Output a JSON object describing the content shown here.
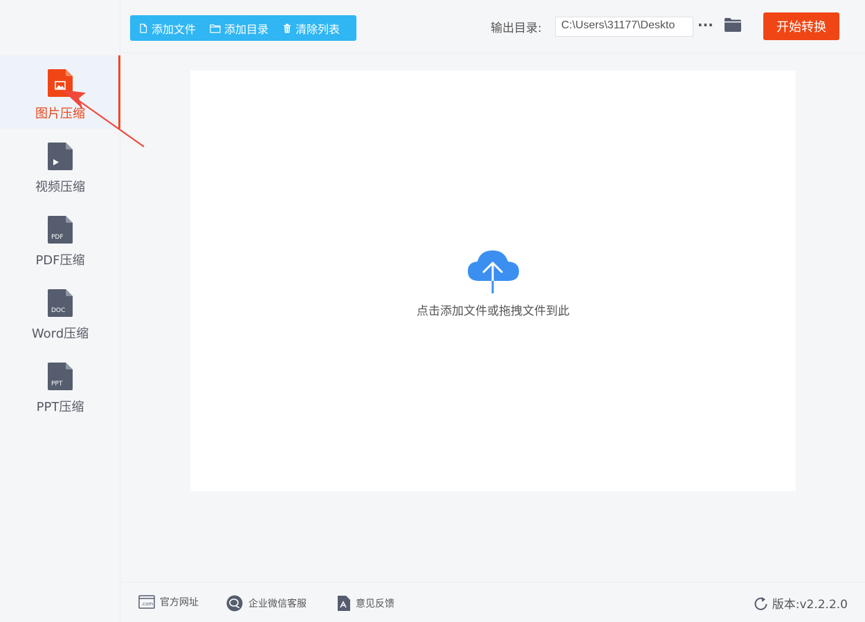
{
  "sidebar": {
    "items": [
      {
        "label": "图片压缩",
        "icon": "image-file-icon",
        "active": true
      },
      {
        "label": "视频压缩",
        "icon": "video-file-icon",
        "badge": "▶"
      },
      {
        "label": "PDF压缩",
        "icon": "pdf-file-icon",
        "badge": "PDF"
      },
      {
        "label": "Word压缩",
        "icon": "doc-file-icon",
        "badge": "DOC"
      },
      {
        "label": "PPT压缩",
        "icon": "ppt-file-icon",
        "badge": "PPT"
      }
    ]
  },
  "toolbar": {
    "add_file": "添加文件",
    "add_folder": "添加目录",
    "clear_list": "清除列表",
    "output_label": "输出目录:",
    "output_path": "C:\\Users\\31177\\Deskto",
    "more": "···",
    "start": "开始转换"
  },
  "main": {
    "drop_hint": "点击添加文件或拖拽文件到此"
  },
  "footer": {
    "website": "官方网址",
    "website_badge": ".com",
    "wechat": "企业微信客服",
    "feedback": "意见反馈",
    "version": "版本:v2.2.2.0"
  },
  "colors": {
    "accent": "#f04615",
    "toolbar": "#2fb6f3",
    "upload": "#3b8ff0",
    "icon_gray": "#555d6e"
  }
}
